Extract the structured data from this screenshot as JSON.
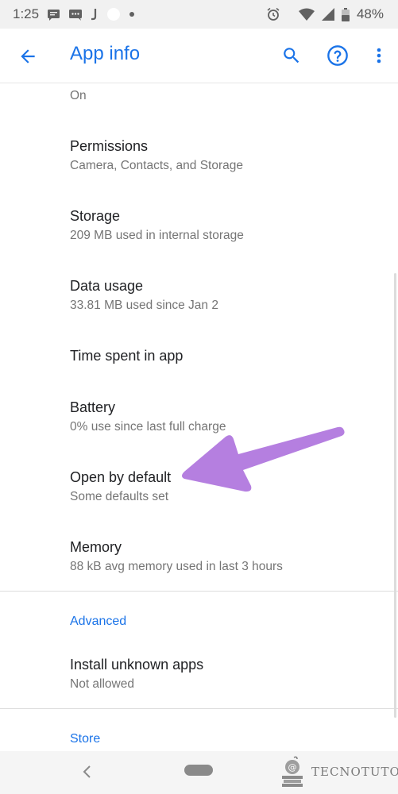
{
  "status_bar": {
    "time": "1:25",
    "battery": "48%",
    "icons": [
      "message-icon",
      "chat-icon",
      "j-app-icon",
      "circle-icon",
      "dot-icon",
      "alarm-icon",
      "wifi-icon",
      "signal-icon",
      "battery-icon"
    ]
  },
  "app_bar": {
    "title": "App info",
    "back_icon": "back-arrow-icon",
    "search_icon": "search-icon",
    "help_icon": "help-icon",
    "more_icon": "more-vert-icon"
  },
  "settings": {
    "notifications_value": "On",
    "permissions": {
      "title": "Permissions",
      "subtitle": "Camera, Contacts, and Storage"
    },
    "storage": {
      "title": "Storage",
      "subtitle": "209 MB used in internal storage"
    },
    "data_usage": {
      "title": "Data usage",
      "subtitle": "33.81 MB used since Jan 2"
    },
    "time_spent": {
      "title": "Time spent in app"
    },
    "battery": {
      "title": "Battery",
      "subtitle": "0% use since last full charge"
    },
    "open_by_default": {
      "title": "Open by default",
      "subtitle": "Some defaults set"
    },
    "memory": {
      "title": "Memory",
      "subtitle": "88 kB avg memory used in last 3 hours"
    }
  },
  "advanced": {
    "header": "Advanced",
    "install_unknown": {
      "title": "Install unknown apps",
      "subtitle": "Not allowed"
    }
  },
  "store": {
    "header": "Store"
  },
  "nav_bar": {
    "back_icon": "nav-back-icon",
    "home_icon": "nav-home-pill"
  },
  "watermark": {
    "text": "TECNOTUTO"
  },
  "colors": {
    "accent": "#1a73e8",
    "arrow": "#b57fe0",
    "text_primary": "#202124",
    "text_secondary": "#757575"
  }
}
